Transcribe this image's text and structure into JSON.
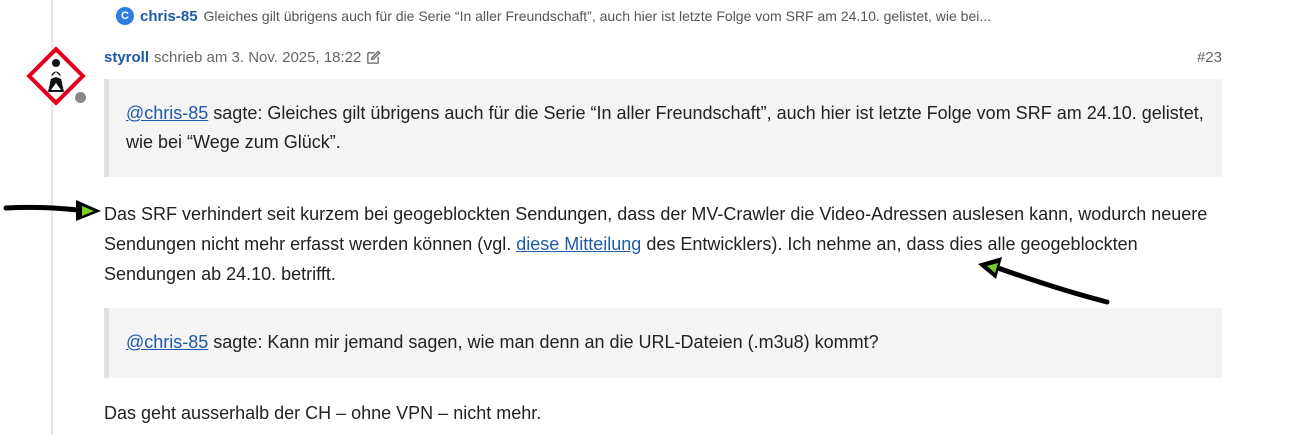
{
  "parent_reply": {
    "avatar_letter": "C",
    "author": "chris-85",
    "excerpt": "Gleiches gilt übrigens auch für die Serie “In aller Freundschaft”, auch hier ist letzte Folge vom SRF am 24.10. gelistet, wie bei..."
  },
  "post": {
    "author": "styroll",
    "meta": "schrieb am 3. Nov. 2025, 18:22",
    "number": "#23",
    "quote1": {
      "mention": "@chris-85",
      "text": " sagte: Gleiches gilt übrigens auch für die Serie “In aller Freundschaft”, auch hier ist letzte Folge vom SRF am 24.10. gelistet, wie bei “Wege zum Glück”."
    },
    "paragraph1": {
      "before": "Das SRF verhindert seit kurzem bei geogeblockten Sendungen, dass der MV-Crawler die Video-Adressen auslesen kann, wodurch neuere Sendungen nicht mehr erfasst werden können (vgl. ",
      "link": "diese Mitteilung",
      "after": " des Entwicklers). Ich nehme an, dass dies alle geogeblockten Sendungen ab 24.10. betrifft."
    },
    "quote2": {
      "mention": "@chris-85",
      "text": " sagte: Kann mir jemand sagen, wie man denn an die URL-Dateien (.m3u8) kommt?"
    },
    "paragraph2": "Das geht ausserhalb der CH – ohne VPN – nicht mehr."
  },
  "colors": {
    "link": "#1e5aa8",
    "quote_bg": "#f4f4f4",
    "avatar_red": "#e3001b",
    "arrow_head": "#7acc29"
  },
  "icons": [
    "edit-icon",
    "hazard-avatar-icon",
    "annotation-arrow-left",
    "annotation-arrow-right"
  ]
}
